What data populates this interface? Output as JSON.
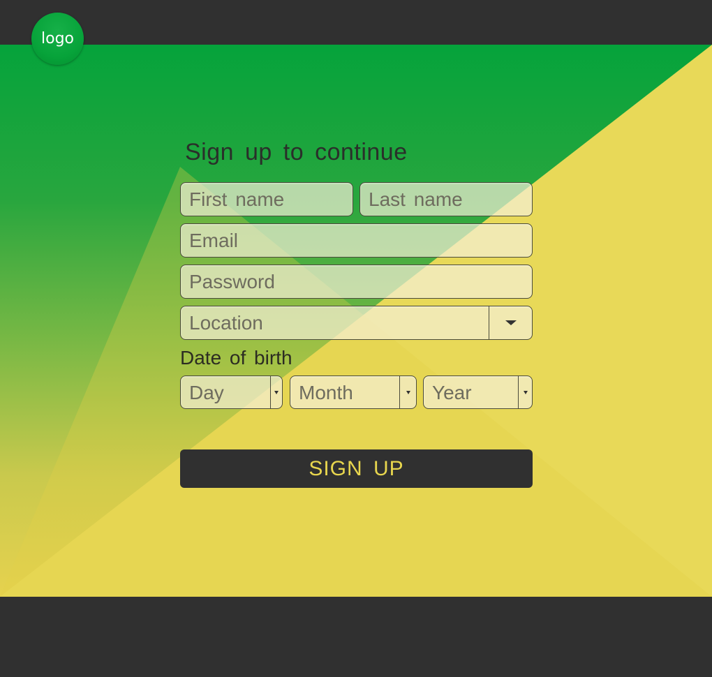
{
  "brand": {
    "logo_text": "logo"
  },
  "colors": {
    "green": "#05a33b",
    "yellow": "#e8d958",
    "dark": "#303030",
    "button_text": "#e8d64e"
  },
  "form": {
    "title": "Sign up to continue",
    "first_name": {
      "placeholder": "First name"
    },
    "last_name": {
      "placeholder": "Last name"
    },
    "email": {
      "placeholder": "Email"
    },
    "password": {
      "placeholder": "Password"
    },
    "location": {
      "placeholder": "Location"
    },
    "dob": {
      "label": "Date of birth",
      "day": {
        "placeholder": "Day"
      },
      "month": {
        "placeholder": "Month"
      },
      "year": {
        "placeholder": "Year"
      }
    },
    "submit_label": "SIGN UP"
  }
}
